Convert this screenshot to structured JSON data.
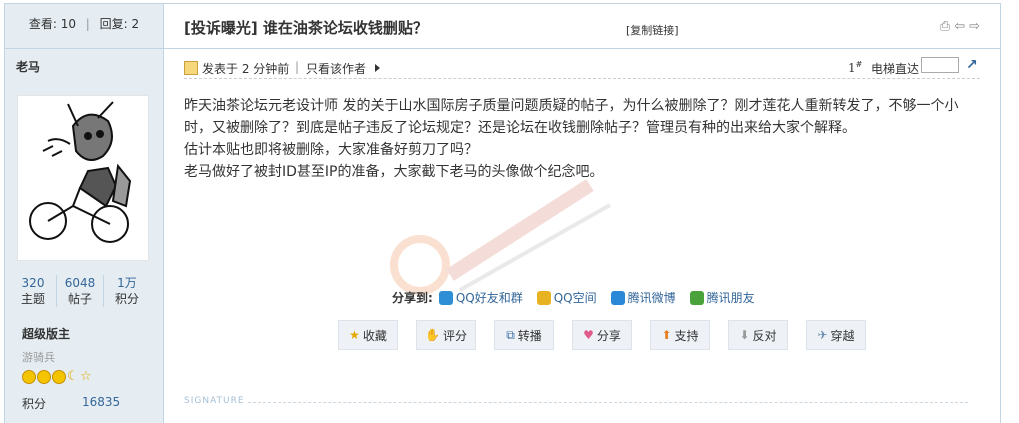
{
  "stats": {
    "views_label": "查看:",
    "views": "10",
    "replies_label": "回复:",
    "replies": "2"
  },
  "thread": {
    "title": "[投诉曝光] 谁在油茶论坛收钱删贴？",
    "copy_link": "[复制链接]"
  },
  "author": {
    "name": "老马",
    "counts": [
      {
        "value": "320",
        "label": "主题"
      },
      {
        "value": "6048",
        "label": "帖子"
      },
      {
        "value": "1万",
        "label": "积分"
      }
    ],
    "group": "超级版主",
    "rank": "游骑兵",
    "points_label": "积分",
    "points": "16835"
  },
  "post": {
    "posted": "发表于 2 分钟前",
    "separator": "|",
    "only_author": "只看该作者",
    "floor": "1",
    "floor_sup": "#",
    "jump_label": "电梯直达",
    "paragraphs": [
      "昨天油茶论坛元老设计师 发的关于山水国际房子质量问题质疑的帖子，为什么被删除了？刚才莲花人重新转发了，不够一个小时，又被删除了？到底是帖子违反了论坛规定？还是论坛在收钱删除帖子？管理员有种的出来给大家个解释。",
      "估计本贴也即将被删除，大家准备好剪刀了吗？",
      "老马做好了被封ID甚至IP的准备，大家截下老马的头像做个纪念吧。"
    ]
  },
  "share": {
    "label": "分享到:",
    "items": [
      {
        "name": "QQ好友和群",
        "color": "#2f8fd6"
      },
      {
        "name": "QQ空间",
        "color": "#e7b322"
      },
      {
        "name": "腾讯微博",
        "color": "#2b88d8"
      },
      {
        "name": "腾讯朋友",
        "color": "#4aa33a"
      }
    ]
  },
  "actions": [
    {
      "label": "收藏",
      "icon": "star-icon"
    },
    {
      "label": "评分",
      "icon": "thumb-icon"
    },
    {
      "label": "转播",
      "icon": "share-box-icon"
    },
    {
      "label": "分享",
      "icon": "heart-icon"
    },
    {
      "label": "支持",
      "icon": "arrow-up-icon"
    },
    {
      "label": "反对",
      "icon": "arrow-down-icon"
    },
    {
      "label": "穿越",
      "icon": "paper-plane-icon"
    }
  ],
  "signature": "SIGNATURE"
}
